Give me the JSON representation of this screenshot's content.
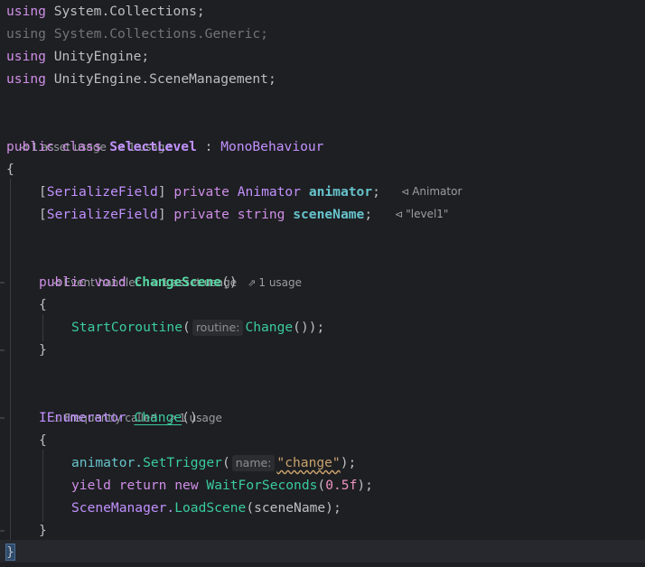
{
  "usings": [
    {
      "kw": "using",
      "ns": "System.Collections;"
    },
    {
      "kw": "using",
      "ns": "System.Collections.Generic;"
    },
    {
      "kw": "using",
      "ns": "UnityEngine;"
    },
    {
      "kw": "using",
      "ns": "UnityEngine.SceneManagement;"
    }
  ],
  "class_lens": {
    "asset_usage": "1 asset usage",
    "usage": "1 usage"
  },
  "class_decl": {
    "mods": "public class",
    "name": "SelectLevel",
    "colon": " : ",
    "base": "MonoBehaviour"
  },
  "brace_open": "{",
  "brace_close": "}",
  "fields": [
    {
      "attr_open": "[",
      "attr": "SerializeField",
      "attr_close": "]",
      "mod": "private",
      "type": "Animator",
      "name": "animator",
      "semi": ";",
      "hint": "Animator"
    },
    {
      "attr_open": "[",
      "attr": "SerializeField",
      "attr_close": "]",
      "mod": "private",
      "type": "string",
      "name": "sceneName",
      "semi": ";",
      "hint": "\"level1\""
    }
  ],
  "method1_lens": {
    "event": "Event handler",
    "asset_usage": "1 asset usage",
    "usage": "1 usage"
  },
  "method1": {
    "mods": "public void",
    "name": "ChangeScene",
    "parens": "()",
    "call": "StartCoroutine",
    "call_open": "(",
    "param_hint": "routine:",
    "arg": "Change",
    "call_close": "());"
  },
  "method2_lens": {
    "freq": "Frequently called",
    "usage": "1 usage"
  },
  "method2": {
    "type": "IEnumerator",
    "name": "Change",
    "parens": "()",
    "l1_obj": "animator.",
    "l1_method": "SetTrigger",
    "l1_open": "(",
    "l1_hint": "name:",
    "l1_str": "\"change\"",
    "l1_close": ");",
    "l2_kw1": "yield",
    "l2_kw2": "return",
    "l2_kw3": "new",
    "l2_type": "WaitForSeconds",
    "l2_open": "(",
    "l2_num": "0.5f",
    "l2_close": ");",
    "l3_obj": "SceneManager.",
    "l3_method": "LoadScene",
    "l3_args": "(sceneName);"
  }
}
